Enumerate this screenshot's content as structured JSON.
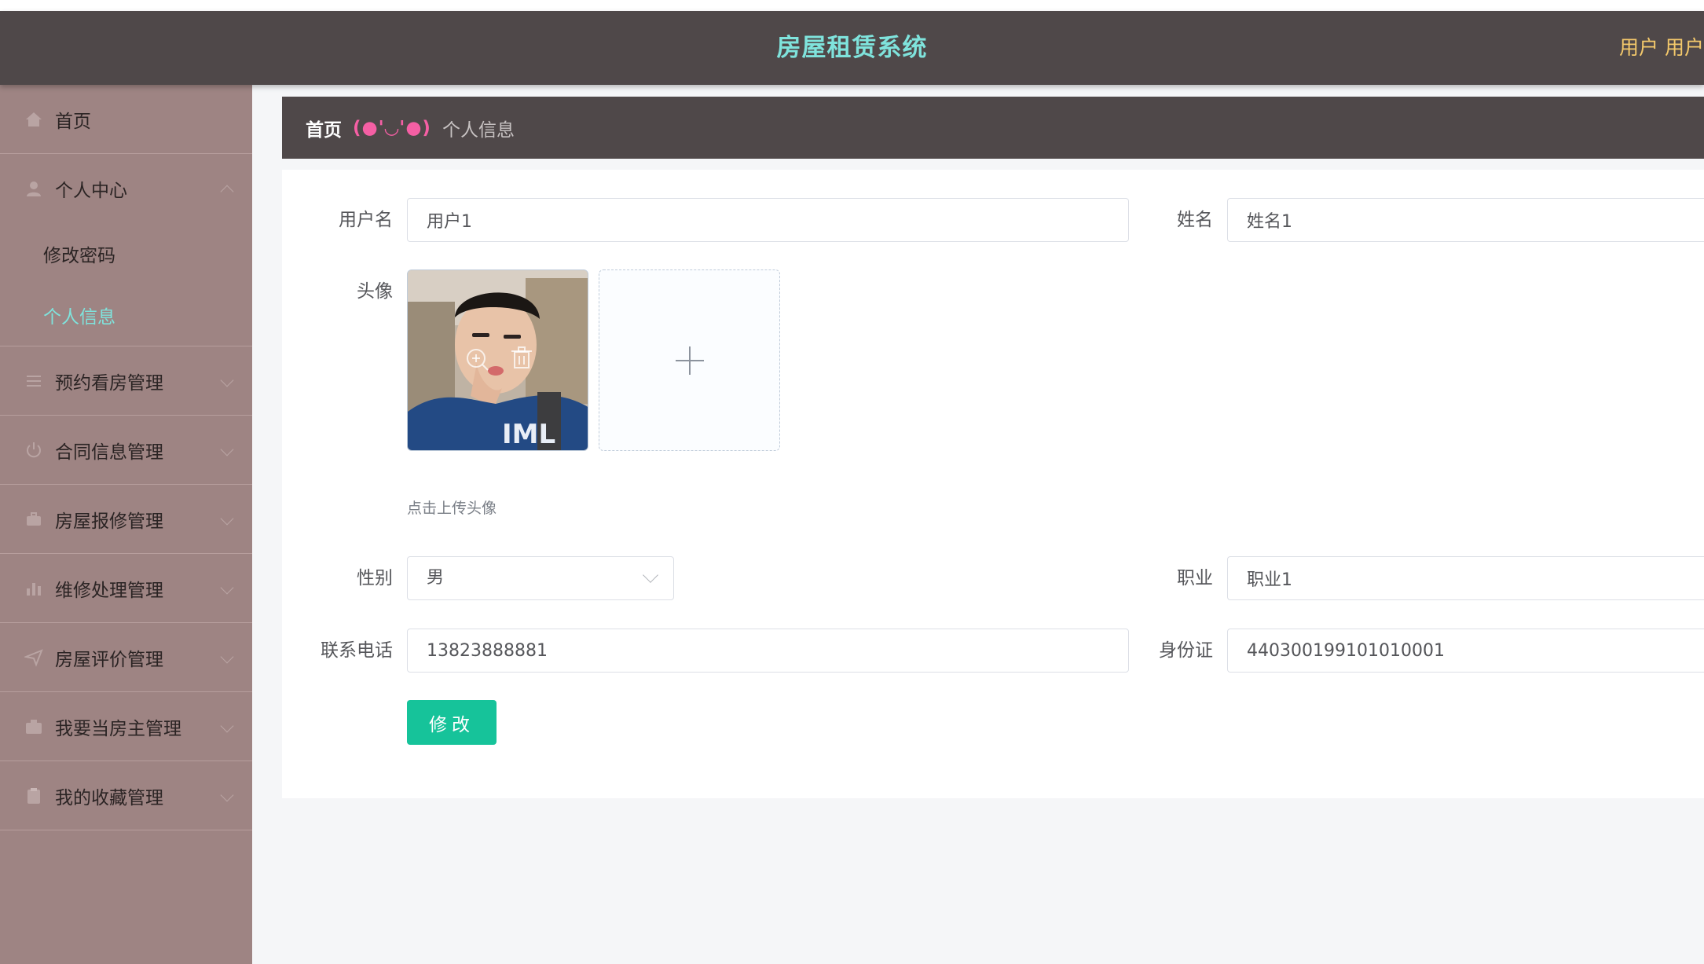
{
  "header": {
    "title": "房屋租赁系统",
    "role": "用户",
    "username": "用户"
  },
  "sidebar": {
    "home": "首页",
    "personal_center": "个人中心",
    "sub_change_password": "修改密码",
    "sub_profile": "个人信息",
    "items": [
      "预约看房管理",
      "合同信息管理",
      "房屋报修管理",
      "维修处理管理",
      "房屋评价管理",
      "我要当房主管理",
      "我的收藏管理"
    ]
  },
  "breadcrumb": {
    "home": "首页",
    "separator": "(●'◡'●)",
    "current": "个人信息"
  },
  "form": {
    "username_label": "用户名",
    "username_value": "用户1",
    "name_label": "姓名",
    "name_value": "姓名1",
    "avatar_label": "头像",
    "avatar_hint": "点击上传头像",
    "gender_label": "性别",
    "gender_value": "男",
    "job_label": "职业",
    "job_value": "职业1",
    "phone_label": "联系电话",
    "phone_value": "13823888881",
    "idcard_label": "身份证",
    "idcard_value": "440300199101010001",
    "submit_label": "修改"
  },
  "colors": {
    "header_bg": "#4f4849",
    "title": "#7fe3dc",
    "user_text": "#f4c96b",
    "sidebar_bg": "#9e8483",
    "active_menu": "#7fe3dc",
    "separator": "#f55fa4",
    "button": "#16c39a"
  }
}
